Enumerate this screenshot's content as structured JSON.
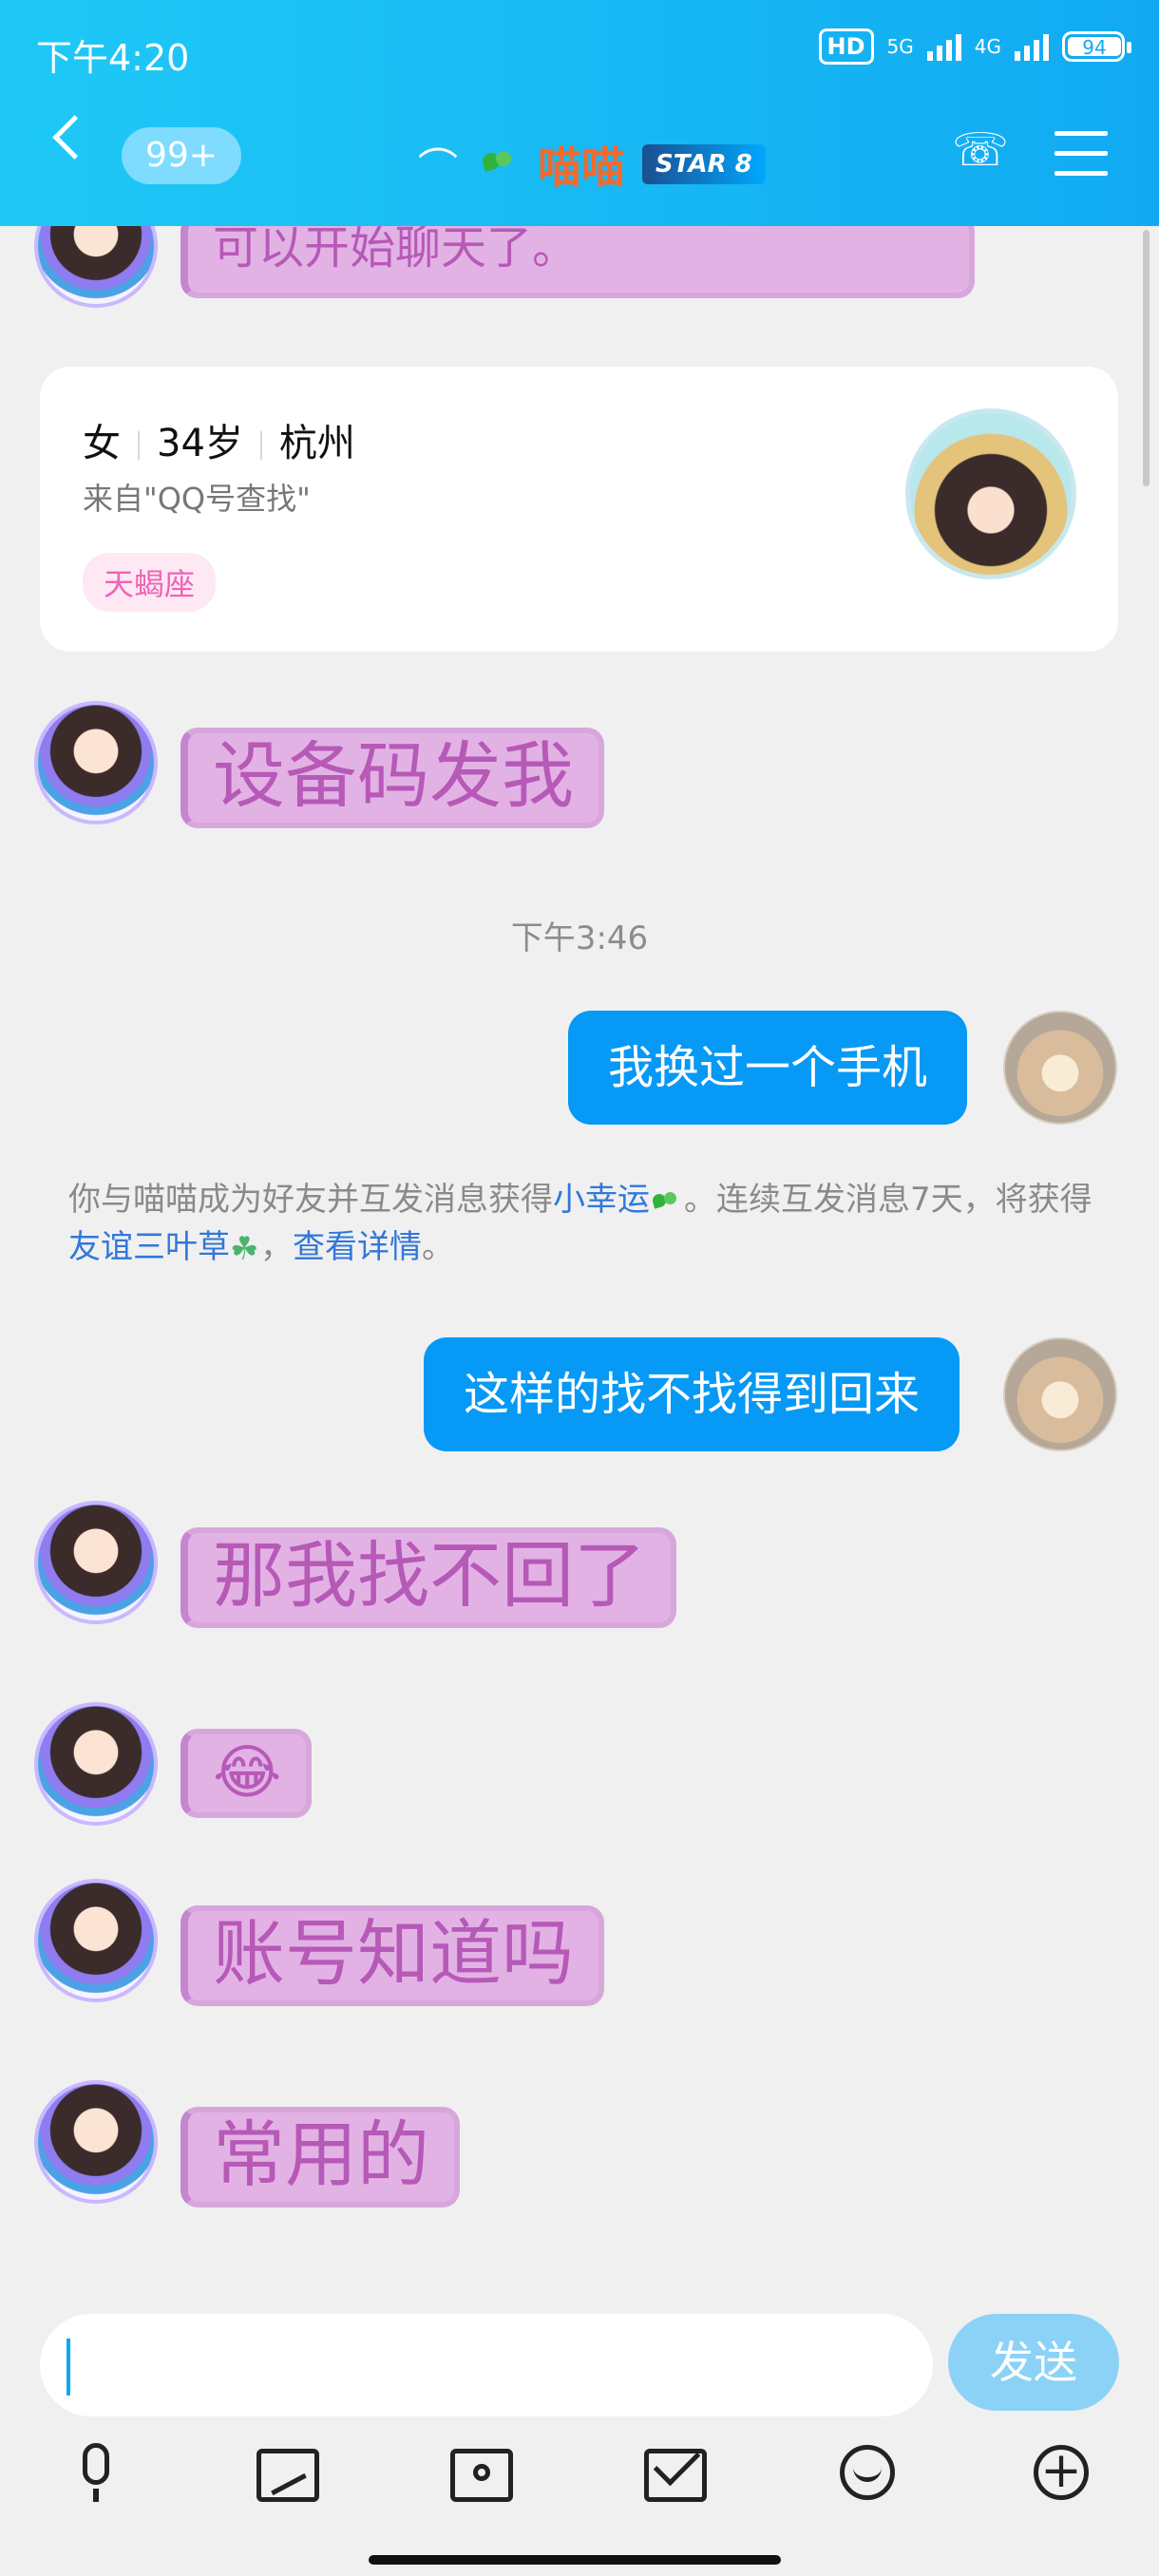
{
  "status": {
    "time": "下午4:20",
    "battery": "94",
    "hd": "HD",
    "network1": "5G",
    "network2": "4G"
  },
  "header": {
    "badge": "99+",
    "name": "喵喵",
    "starbadge": "STAR 8"
  },
  "profile": {
    "gender": "女",
    "age": "34岁",
    "city": "杭州",
    "from": "来自\"QQ号查找\"",
    "tag": "天蝎座"
  },
  "messages": [
    {
      "text": "可以开始聊天了。"
    },
    {
      "text": "设备码发我"
    },
    {
      "text": "我换过一个手机"
    },
    {
      "text": "这样的找不找得到回来"
    },
    {
      "text": "那我找不回了"
    },
    {
      "text": "😂"
    },
    {
      "text": "账号知道吗"
    },
    {
      "text": "常用的"
    }
  ],
  "time_label": "下午3:46",
  "system": {
    "prefix": "你与喵喵成为好友并互发消息获得",
    "link1": "小幸运",
    "middle": "。连续互发消息7天，将获得",
    "link2": "友谊三叶草",
    "suffix2": "，",
    "link3": "查看详情",
    "end": "。"
  },
  "composer": {
    "send_label": "发送"
  }
}
